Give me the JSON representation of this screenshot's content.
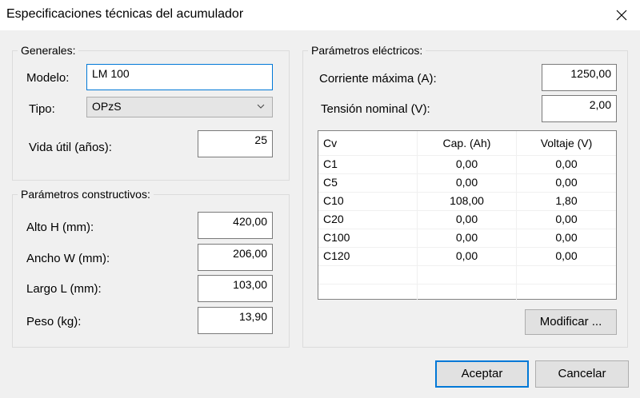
{
  "window": {
    "title": "Especificaciones técnicas del acumulador",
    "close_icon": "close-icon"
  },
  "general": {
    "title": "Generales:",
    "model_label": "Modelo:",
    "model_value": "LM 100",
    "type_label": "Tipo:",
    "type_value": "OPzS",
    "life_label": "Vida útil (años):",
    "life_value": "25"
  },
  "constructive": {
    "title": "Parámetros constructivos:",
    "height_label": "Alto H (mm):",
    "height_value": "420,00",
    "width_label": "Ancho W (mm):",
    "width_value": "206,00",
    "length_label": "Largo L (mm):",
    "length_value": "103,00",
    "weight_label": "Peso (kg):",
    "weight_value": "13,90"
  },
  "electrical": {
    "title": "Parámetros eléctricos:",
    "max_current_label": "Corriente máxima (A):",
    "max_current_value": "1250,00",
    "nominal_voltage_label": "Tensión nominal (V):",
    "nominal_voltage_value": "2,00",
    "table": {
      "headers": [
        "Cv",
        "Cap. (Ah)",
        "Voltaje (V)"
      ],
      "rows": [
        [
          "C1",
          "0,00",
          "0,00"
        ],
        [
          "C5",
          "0,00",
          "0,00"
        ],
        [
          "C10",
          "108,00",
          "1,80"
        ],
        [
          "C20",
          "0,00",
          "0,00"
        ],
        [
          "C100",
          "0,00",
          "0,00"
        ],
        [
          "C120",
          "0,00",
          "0,00"
        ]
      ]
    },
    "modify_button": "Modificar ..."
  },
  "footer": {
    "accept_button": "Aceptar",
    "cancel_button": "Cancelar"
  },
  "colors": {
    "accent": "#0078d7",
    "background": "#f0f0f0"
  }
}
